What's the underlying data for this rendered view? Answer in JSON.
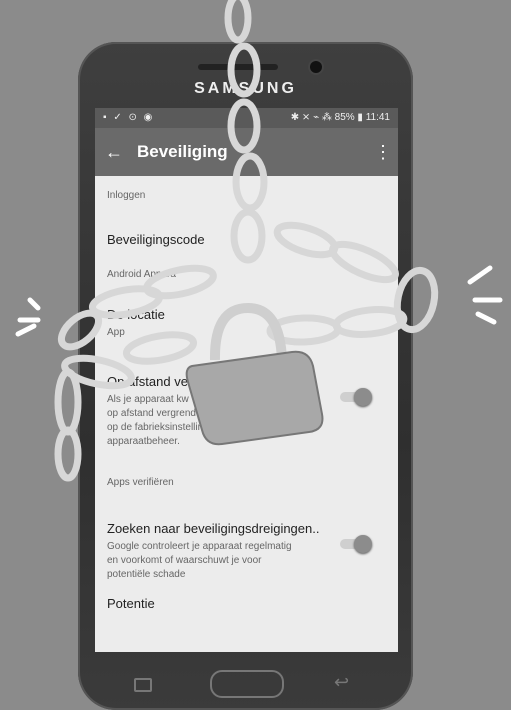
{
  "phone": {
    "brand": "SAMSUNG"
  },
  "statusbar": {
    "left_icons": "▪ ✓ ⊙ ◉",
    "right_status": "✱ ⨯ ⌁ ⁂ 85% ▮ 11:41"
  },
  "toolbar": {
    "title": "Beveiliging",
    "back_icon": "←",
    "menu_icon": "⋮"
  },
  "sections": {
    "login_header": "Inloggen",
    "security_code": "Beveiligingscode",
    "android_header": "Android Appara",
    "location_title": "De locatie",
    "location_summary": "App",
    "remote_lock_title": "Op afstand vergr",
    "remote_lock_summary": "Als je apparaat kw\nop afstand vergrende\nop de fabrieksinstellingen met Android-\napparaatbeheer.",
    "apps_header": "Apps verifiëren",
    "search_title": "Zoeken naar beveiligingsdreigingen..",
    "search_summary": "Google controleert je apparaat regelmatig\nen voorkomt of waarschuwt je voor\npotentiële schade",
    "last_item": "Potentie"
  }
}
